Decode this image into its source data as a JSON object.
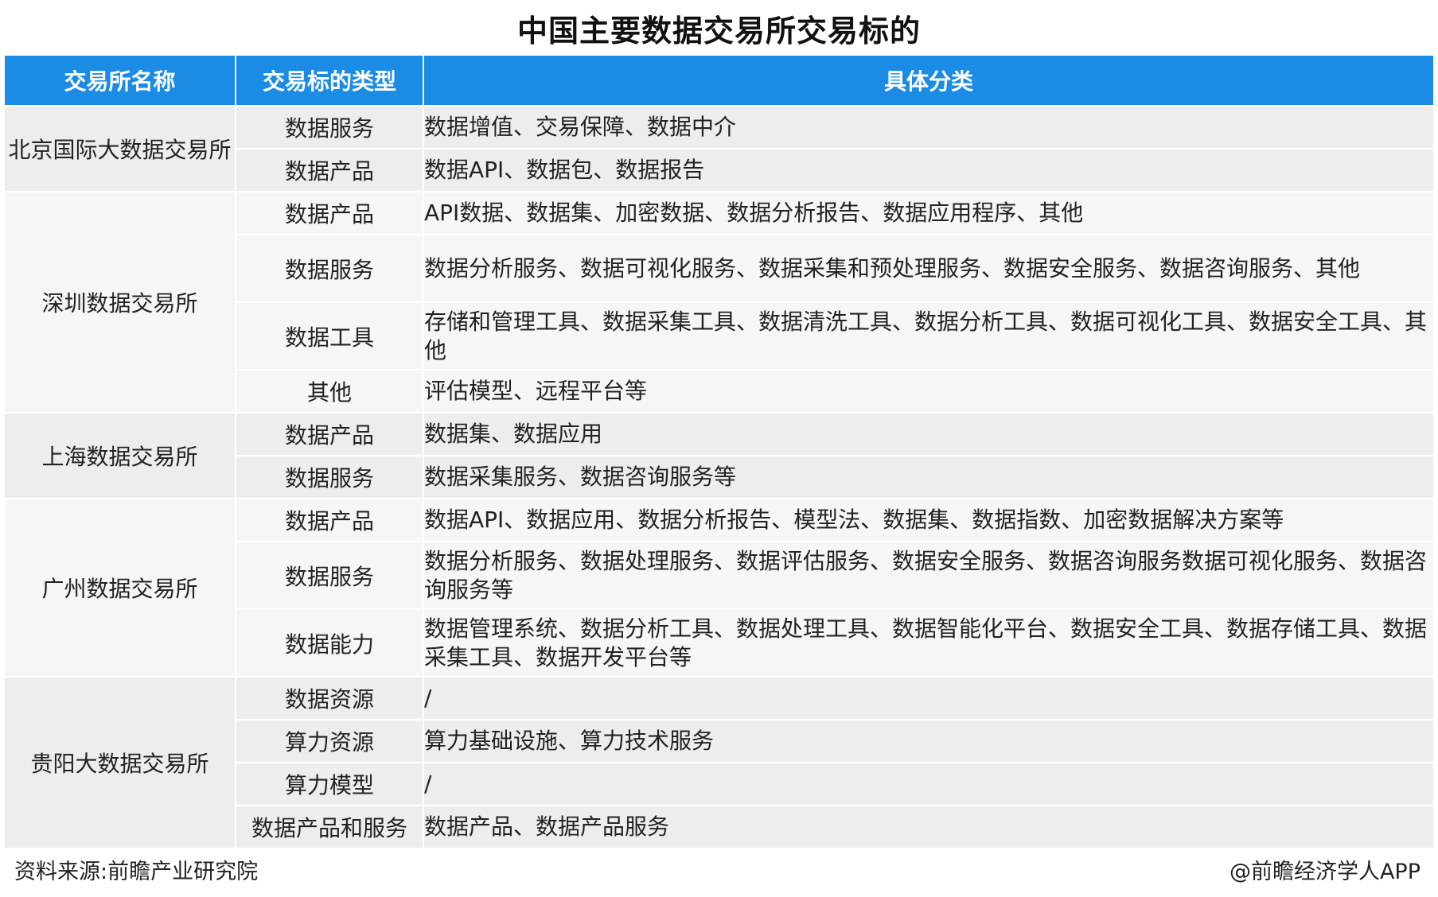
{
  "title": "中国主要数据交易所交易标的",
  "headers": [
    "交易所名称",
    "交易标的类型",
    "具体分类"
  ],
  "colors": {
    "header_bg": "#1b8ce5",
    "row_shade_a": "#ededed",
    "row_shade_b": "#f6f6f6"
  },
  "groups": [
    {
      "exchange": "北京国际大数据交易所",
      "rows": [
        {
          "type": "数据服务",
          "detail": "数据增值、交易保障、数据中介"
        },
        {
          "type": "数据产品",
          "detail": "数据API、数据包、数据报告"
        }
      ]
    },
    {
      "exchange": "深圳数据交易所",
      "rows": [
        {
          "type": "数据产品",
          "detail": "API数据、数据集、加密数据、数据分析报告、数据应用程序、其他"
        },
        {
          "type": "数据服务",
          "detail": "数据分析服务、数据可视化服务、数据采集和预处理服务、数据安全服务、数据咨询服务、其他"
        },
        {
          "type": "数据工具",
          "detail": "存储和管理工具、数据采集工具、数据清洗工具、数据分析工具、数据可视化工具、数据安全工具、其他"
        },
        {
          "type": "其他",
          "detail": "评估模型、远程平台等"
        }
      ]
    },
    {
      "exchange": "上海数据交易所",
      "rows": [
        {
          "type": "数据产品",
          "detail": "数据集、数据应用"
        },
        {
          "type": "数据服务",
          "detail": "数据采集服务、数据咨询服务等"
        }
      ]
    },
    {
      "exchange": "广州数据交易所",
      "rows": [
        {
          "type": "数据产品",
          "detail": "数据API、数据应用、数据分析报告、模型法、数据集、数据指数、加密数据解决方案等"
        },
        {
          "type": "数据服务",
          "detail": "数据分析服务、数据处理服务、数据评估服务、数据安全服务、数据咨询服务数据可视化服务、数据咨询服务等"
        },
        {
          "type": "数据能力",
          "detail": "数据管理系统、数据分析工具、数据处理工具、数据智能化平台、数据安全工具、数据存储工具、数据采集工具、数据开发平台等"
        }
      ]
    },
    {
      "exchange": "贵阳大数据交易所",
      "rows": [
        {
          "type": "数据资源",
          "detail": "/"
        },
        {
          "type": "算力资源",
          "detail": "算力基础设施、算力技术服务"
        },
        {
          "type": "算力模型",
          "detail": "/"
        },
        {
          "type": "数据产品和服务",
          "detail": "数据产品、数据产品服务"
        }
      ]
    }
  ],
  "footer": {
    "source": "资料来源:前瞻产业研究院",
    "credit": "@前瞻经济学人APP"
  }
}
